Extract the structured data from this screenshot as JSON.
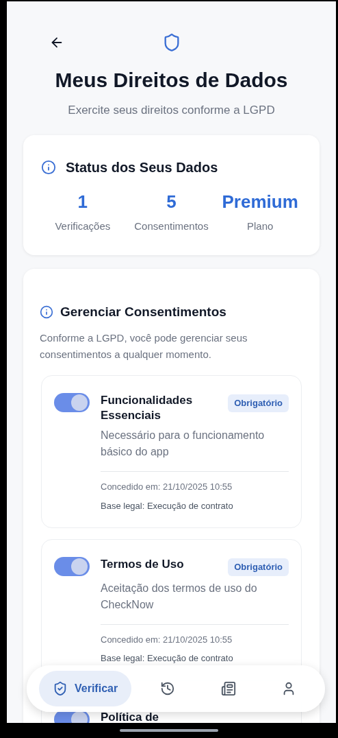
{
  "header": {
    "title": "Meus Direitos de Dados",
    "subtitle": "Exercite seus direitos conforme a LGPD"
  },
  "status": {
    "title": "Status dos Seus Dados",
    "stats": [
      {
        "value": "1",
        "label": "Verificações"
      },
      {
        "value": "5",
        "label": "Consentimentos"
      },
      {
        "value": "Premium",
        "label": "Plano"
      }
    ]
  },
  "consents": {
    "title": "Gerenciar Consentimentos",
    "description": "Conforme a LGPD, você pode gerenciar seus consentimentos a qualquer momento.",
    "items": [
      {
        "title": "Funcionalidades Essenciais",
        "badge": "Obrigatório",
        "on": true,
        "description": "Necessário para o funcionamento básico do app",
        "granted": "Concedido em: 21/10/2025 10:55",
        "legal_basis": "Base legal: Execução de contrato"
      },
      {
        "title": "Termos de Uso",
        "badge": "Obrigatório",
        "on": true,
        "description": "Aceitação dos termos de uso do CheckNow",
        "granted": "Concedido em: 21/10/2025 10:55",
        "legal_basis": "Base legal: Execução de contrato"
      },
      {
        "title": "Política de",
        "on": true
      }
    ]
  },
  "nav": [
    {
      "kind": "verify",
      "label": "Verificar",
      "selected": true
    },
    {
      "kind": "history",
      "selected": false
    },
    {
      "kind": "news",
      "selected": false
    },
    {
      "kind": "profile",
      "selected": false
    }
  ]
}
